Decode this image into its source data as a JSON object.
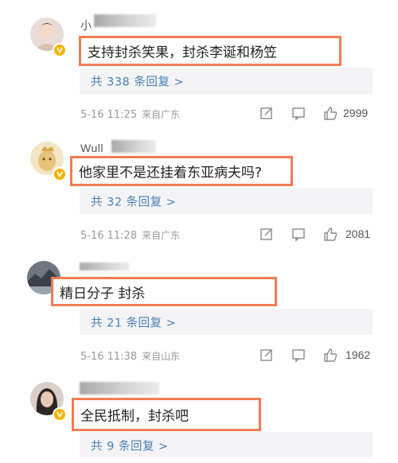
{
  "comments": [
    {
      "username_fragment": "小",
      "text": "支持封杀笑果，封杀李诞和杨笠",
      "replies": "共 338 条回复 >",
      "datetime": "5-16 11:25",
      "location": "来自广东",
      "likes": "2999"
    },
    {
      "username_fragment": "Wull",
      "text": "他家里不是还挂着东亚病夫吗?",
      "replies": "共 32 条回复 >",
      "datetime": "5-16 11:28",
      "location": "来自广东",
      "likes": "2081"
    },
    {
      "username_fragment": "",
      "text": "精日分子  封杀",
      "replies": "共 21 条回复 >",
      "datetime": "5-16 11:38",
      "location": "来自山东",
      "likes": "1962"
    },
    {
      "username_fragment": "",
      "text": "全民抵制，封杀吧",
      "replies": "共 9 条回复 >",
      "datetime": "",
      "location": "",
      "likes": ""
    }
  ],
  "icons": {
    "repost": "edit-square-icon",
    "comment": "comment-icon",
    "like": "thumbs-up-icon",
    "verified": "verified-v-badge-icon"
  },
  "colors": {
    "highlight_border": "#f07c53",
    "reply_text": "#4a7fb3",
    "reply_bg": "#f4f4f6",
    "badge": "#f5b400"
  }
}
